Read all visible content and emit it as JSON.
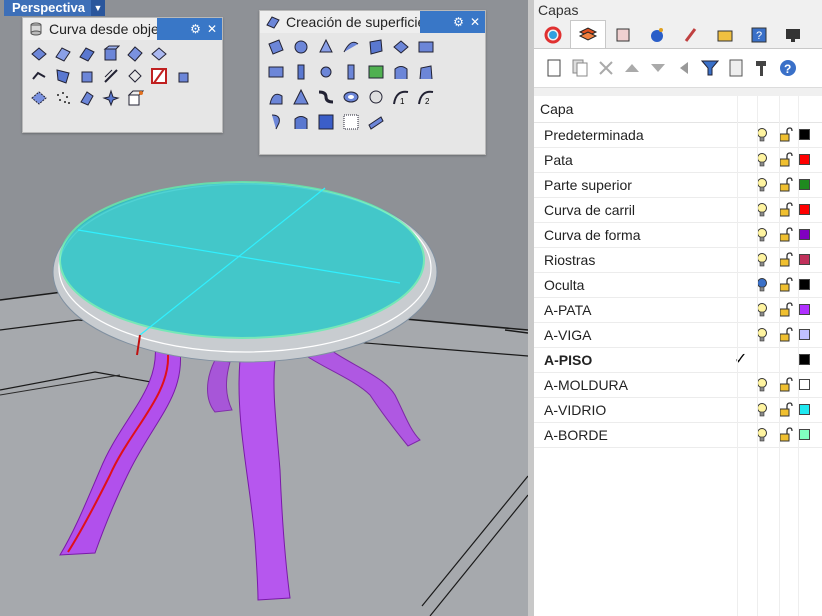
{
  "viewport": {
    "label": "Perspectiva"
  },
  "toolbar1": {
    "title": "Curva desde objetos"
  },
  "toolbar2": {
    "title": "Creación de superficies"
  },
  "panel": {
    "title": "Capas",
    "header": "Capa",
    "tabs": [
      "color-wheel-icon",
      "layers-icon",
      "properties-icon",
      "render-icon",
      "brush-icon",
      "folder-icon",
      "help-icon",
      "display-icon"
    ],
    "tools": [
      "new-layer-icon",
      "copy-layer-icon",
      "delete-icon",
      "move-up-icon",
      "move-down-icon",
      "collapse-icon",
      "filter-icon",
      "document-icon",
      "hammer-icon",
      "help-icon"
    ],
    "layers": [
      {
        "name": "Predeterminada",
        "color": "#000000"
      },
      {
        "name": "Pata",
        "color": "#ff0000"
      },
      {
        "name": "Parte superior",
        "color": "#1f8a1f"
      },
      {
        "name": "Curva de carril",
        "color": "#ff0000"
      },
      {
        "name": "Curva de forma",
        "color": "#8000c0"
      },
      {
        "name": "Riostras",
        "color": "#c0305a"
      },
      {
        "name": "Oculta",
        "color": "#000000"
      },
      {
        "name": "A-PATA",
        "color": "#b030ff"
      },
      {
        "name": "A-VIGA",
        "color": "#c0c0ff"
      },
      {
        "name": "A-PISO",
        "color": "#000000"
      },
      {
        "name": "A-MOLDURA",
        "color": "#ffffff"
      },
      {
        "name": "A-VIDRIO",
        "color": "#20e8f0"
      },
      {
        "name": "A-BORDE",
        "color": "#80ffc0"
      }
    ],
    "current_layer": "A-PISO",
    "hidden_layer": "Oculta"
  }
}
